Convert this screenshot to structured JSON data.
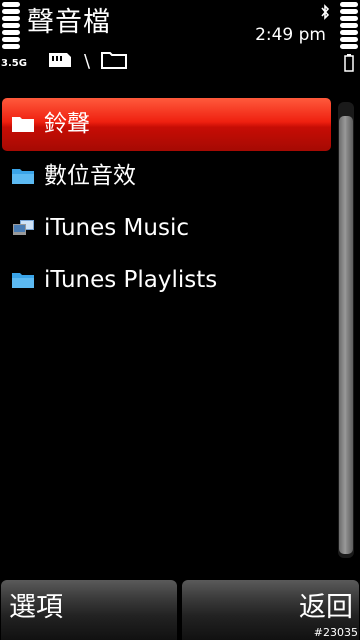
{
  "header": {
    "title": "聲音檔",
    "network": "3.5G",
    "path_separator": "\\",
    "clock": "2:49 pm"
  },
  "icons": {
    "memory_card": "memory-card-icon",
    "folder": "folder-icon",
    "bluetooth": "bluetooth-icon",
    "battery": "battery-icon",
    "signal": "signal-strength-icon"
  },
  "list": {
    "items": [
      {
        "label": "鈴聲",
        "icon": "folder-icon",
        "selected": true
      },
      {
        "label": "數位音效",
        "icon": "folder-icon",
        "selected": false
      },
      {
        "label": "iTunes Music",
        "icon": "media-folder-icon",
        "selected": false
      },
      {
        "label": "iTunes Playlists",
        "icon": "folder-icon",
        "selected": false
      }
    ]
  },
  "softkeys": {
    "left": "選項",
    "right": "返回"
  },
  "footer": {
    "id_text": "#23035"
  },
  "colors": {
    "background": "#000000",
    "highlight": "#e8200f",
    "folder_blue": "#3aa4e8",
    "text": "#ffffff"
  }
}
